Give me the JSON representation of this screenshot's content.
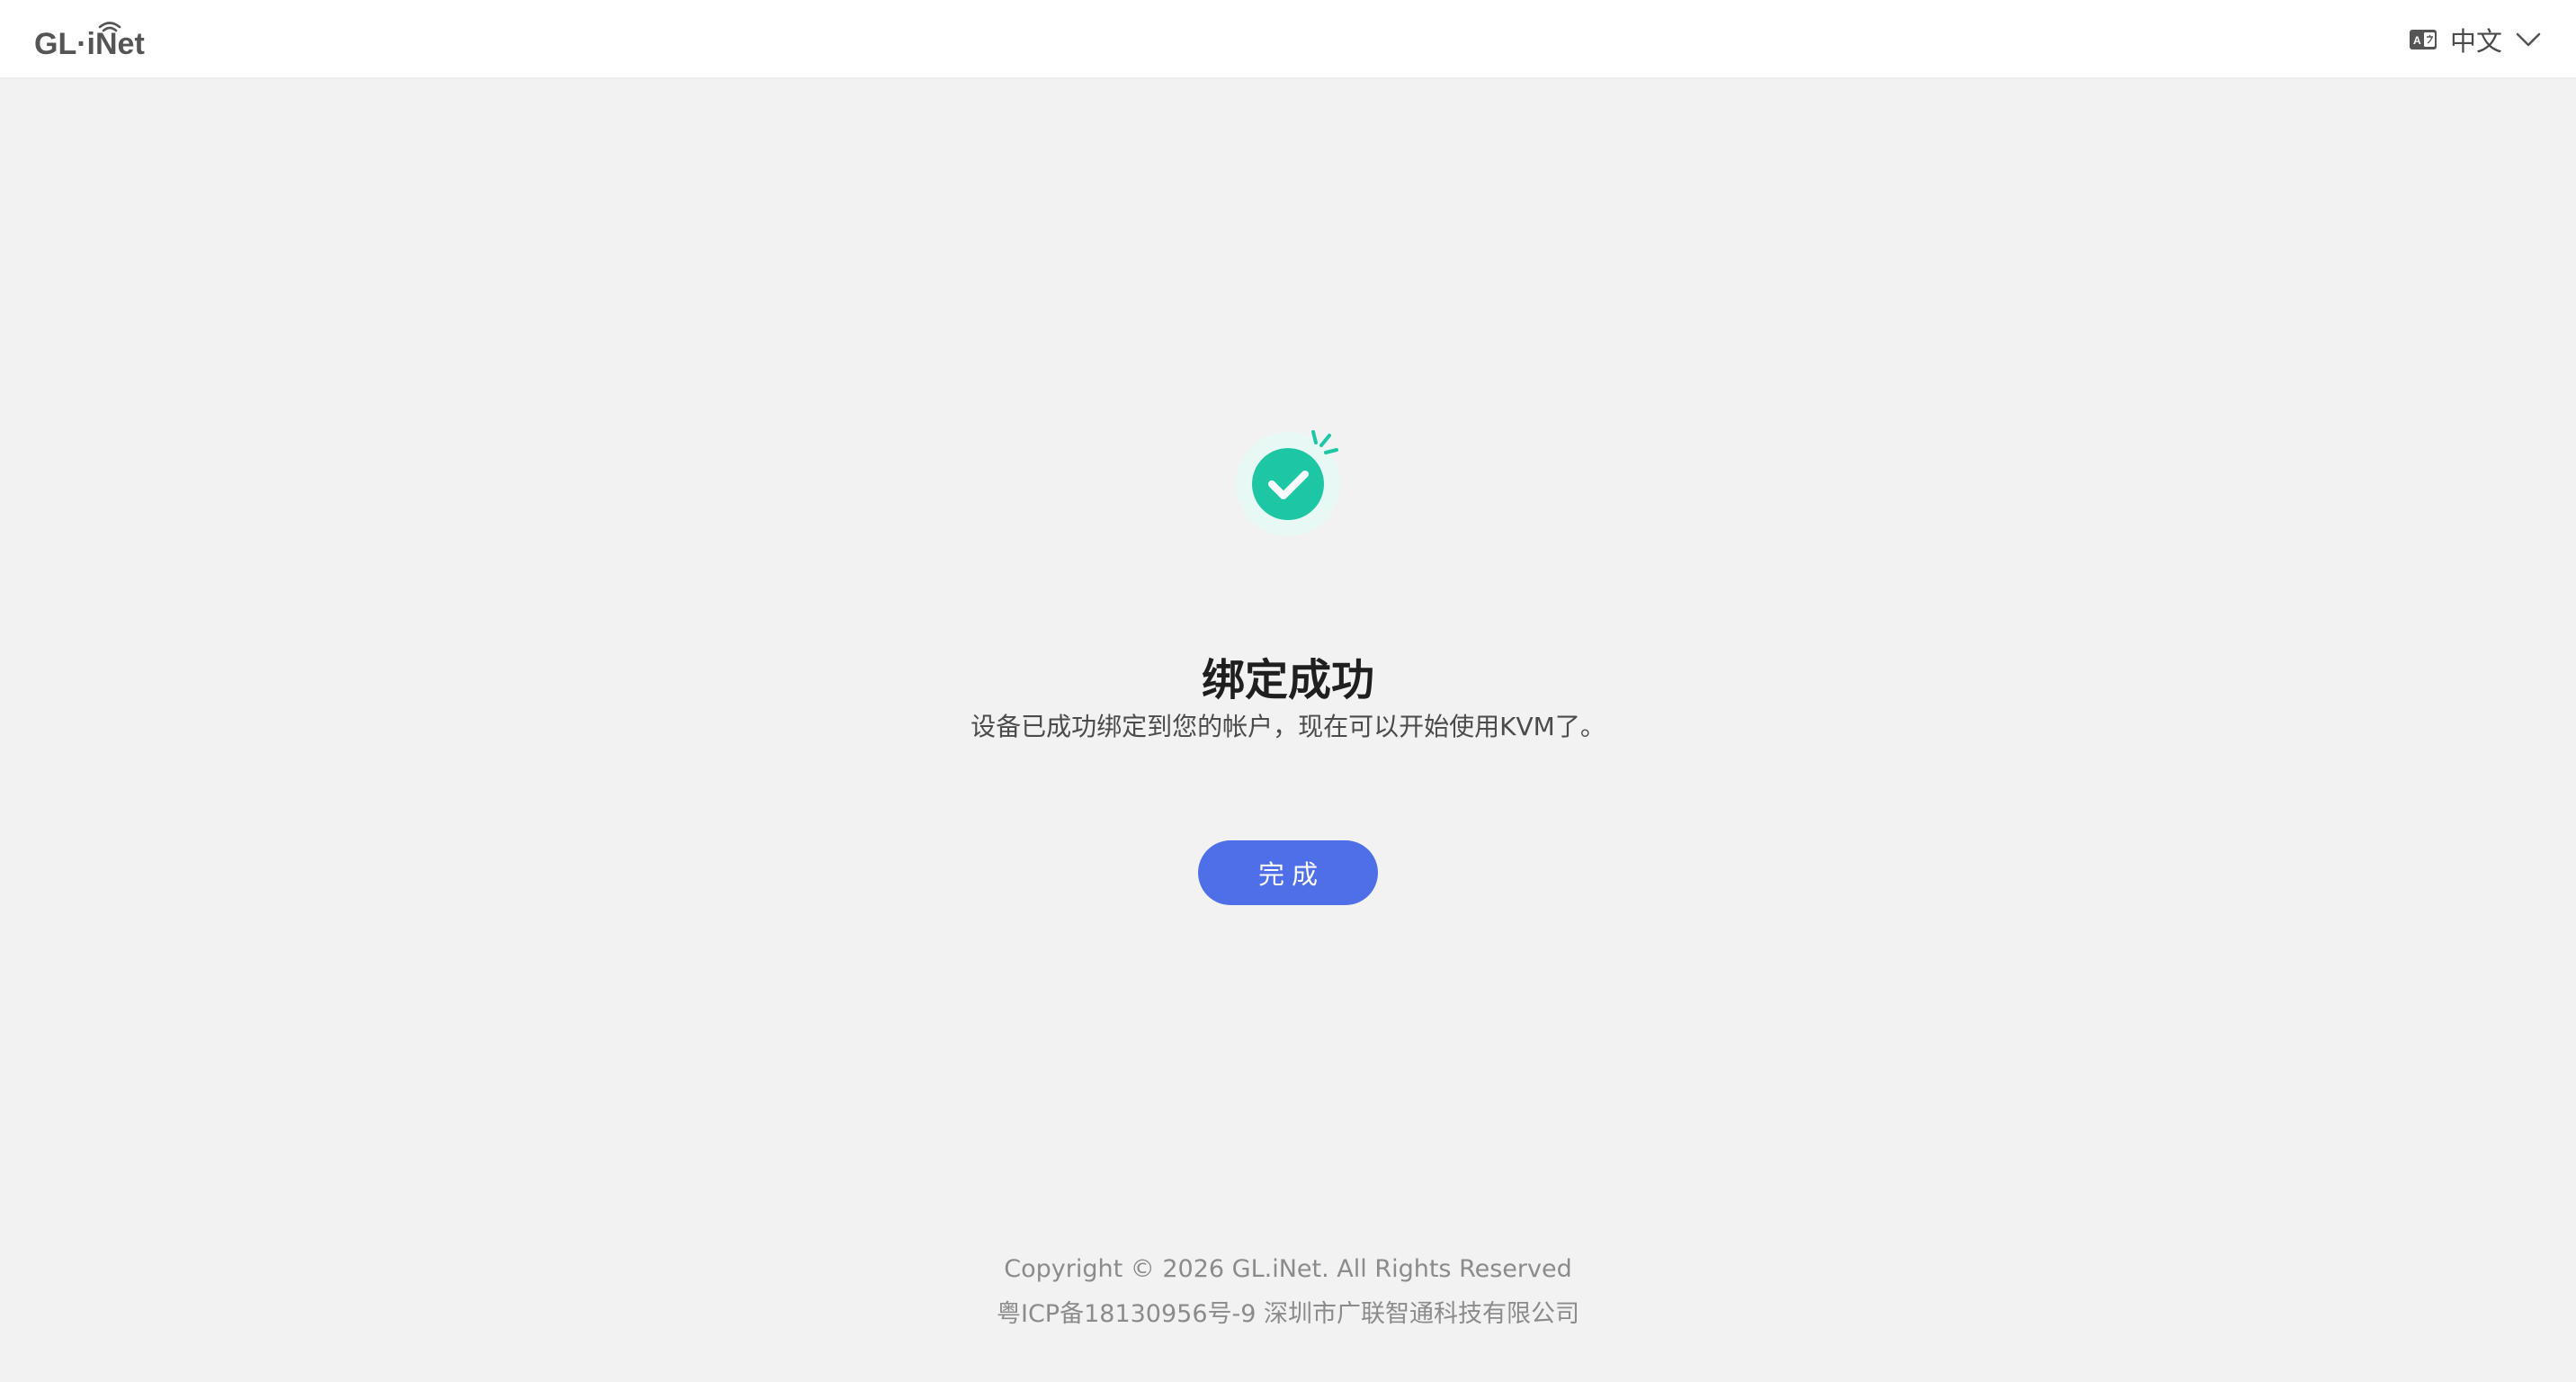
{
  "header": {
    "logo_text": "GL·iNet",
    "language": {
      "icon": "translate-icon",
      "label": "中文",
      "chevron": "chevron-down-icon"
    }
  },
  "main": {
    "status_icon": "check-circle-icon",
    "title": "绑定成功",
    "subtitle": "设备已成功绑定到您的帐户，现在可以开始使用KVM了。",
    "done_label": "完成"
  },
  "footer": {
    "copyright": "Copyright © 2026 GL.iNet. All Rights Reserved",
    "icp": "粤ICP备18130956号-9 深圳市广联智通科技有限公司"
  },
  "colors": {
    "accent": "#4f6fe8",
    "success": "#1dc7a5",
    "background": "#f2f2f3"
  }
}
